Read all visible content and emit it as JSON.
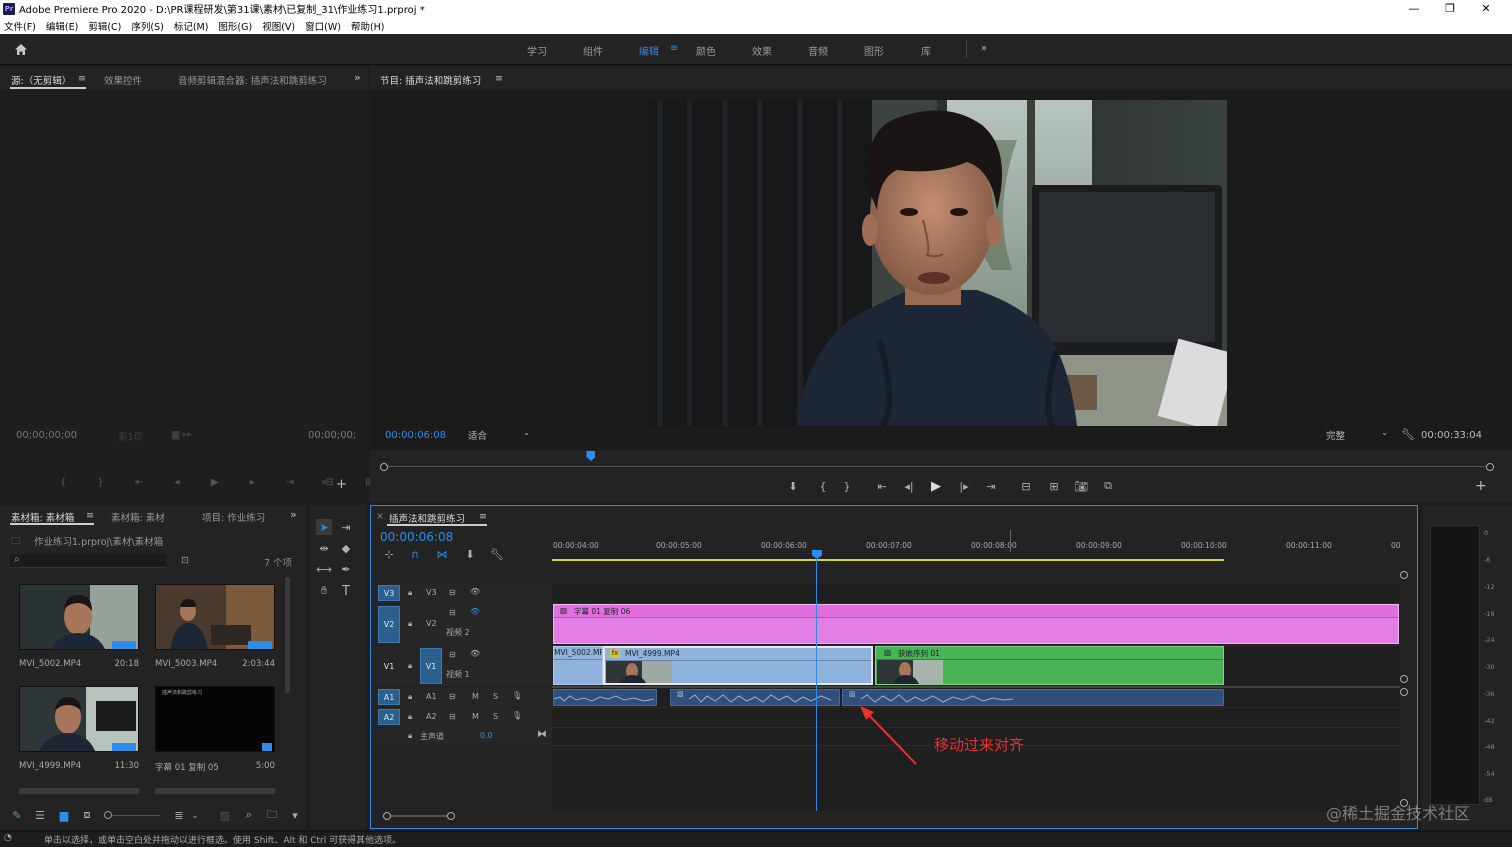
{
  "titlebar": {
    "title": "Adobe Premiere Pro 2020 - D:\\PR课程研发\\第31课\\素材\\已复制_31\\作业练习1.prproj *",
    "logo": "Pr"
  },
  "menu": [
    "文件(F)",
    "编辑(E)",
    "剪辑(C)",
    "序列(S)",
    "标记(M)",
    "图形(G)",
    "视图(V)",
    "窗口(W)",
    "帮助(H)"
  ],
  "workspaces": [
    "学习",
    "组件",
    "编辑",
    "颜色",
    "效果",
    "音频",
    "图形",
    "库"
  ],
  "active_workspace": "编辑",
  "source_panel": {
    "tabs": [
      "源:（无剪辑）",
      "效果控件",
      "音频剪辑混合器: 插声法和跳剪练习"
    ],
    "timecode_left": "00;00;00;00",
    "timecode_right": "00;00;00;",
    "page_label": "第1页"
  },
  "program_panel": {
    "tab": "节目: 插声法和跳剪练习",
    "timecode": "00:00:06:08",
    "fit": "适合",
    "quality": "完整",
    "duration": "00:00:33:04",
    "playhead_fraction": 0.187
  },
  "project_panel": {
    "tabs": [
      "素材箱: 素材箱",
      "素材箱: 素材",
      "项目: 作业练习"
    ],
    "path": "作业练习1.prproj\\素材\\素材箱",
    "count": "7 个项",
    "items": [
      {
        "name": "MVI_5002.MP4",
        "duration": "20:18"
      },
      {
        "name": "MVI_5003.MP4",
        "duration": "2:03:44"
      },
      {
        "name": "MVI_4999.MP4",
        "duration": "11:30"
      },
      {
        "name": "字幕 01 复制 05",
        "duration": "5:00"
      }
    ],
    "title_thumb_text": "插声法和跳剪练习"
  },
  "timeline": {
    "tab": "插声法和跳剪练习",
    "timecode": "00:00:06:08",
    "ruler": [
      "00:00:04:00",
      "00:00:05:00",
      "00:00:06:00",
      "00:00:07:00",
      "00:00:08:00",
      "00:00:09:00",
      "00:00:10:00",
      "00:00:11:00",
      "00"
    ],
    "tracks": {
      "v3": "V3",
      "v2": "V2",
      "v2_name": "视频 2",
      "v1": "V1",
      "v1_name": "视频 1",
      "a1": "A1",
      "a2": "A2",
      "master": "主声道",
      "master_value": "0.0",
      "m": "M",
      "s": "S"
    },
    "clips": {
      "title_clip": "字幕 01 复制 06",
      "clip_5002": "MVI_5002.MP4",
      "clip_4999": "MVI_4999.MP4",
      "nested_seq": "获嵌序列 01",
      "fx_badge": "fx"
    },
    "annotation": "移动过来对齐"
  },
  "meter_scale": [
    "0",
    "-6",
    "-12",
    "-18",
    "-24",
    "-30",
    "-36",
    "-42",
    "-48",
    "-54",
    "dB"
  ],
  "status": "单击以选择，或单击空白处并拖动以进行框选。使用 Shift、Alt 和 Ctrl 可获得其他选项。",
  "watermark": "@稀土掘金技术社区",
  "colors": {
    "accent": "#2d8ceb",
    "title_clip": "#e37fe4",
    "video_clip": "#8fb3dd",
    "nested_clip": "#48b455",
    "audio_clip": "#304f7a",
    "annotation": "#e8322e",
    "work_area": "#d6d138"
  }
}
